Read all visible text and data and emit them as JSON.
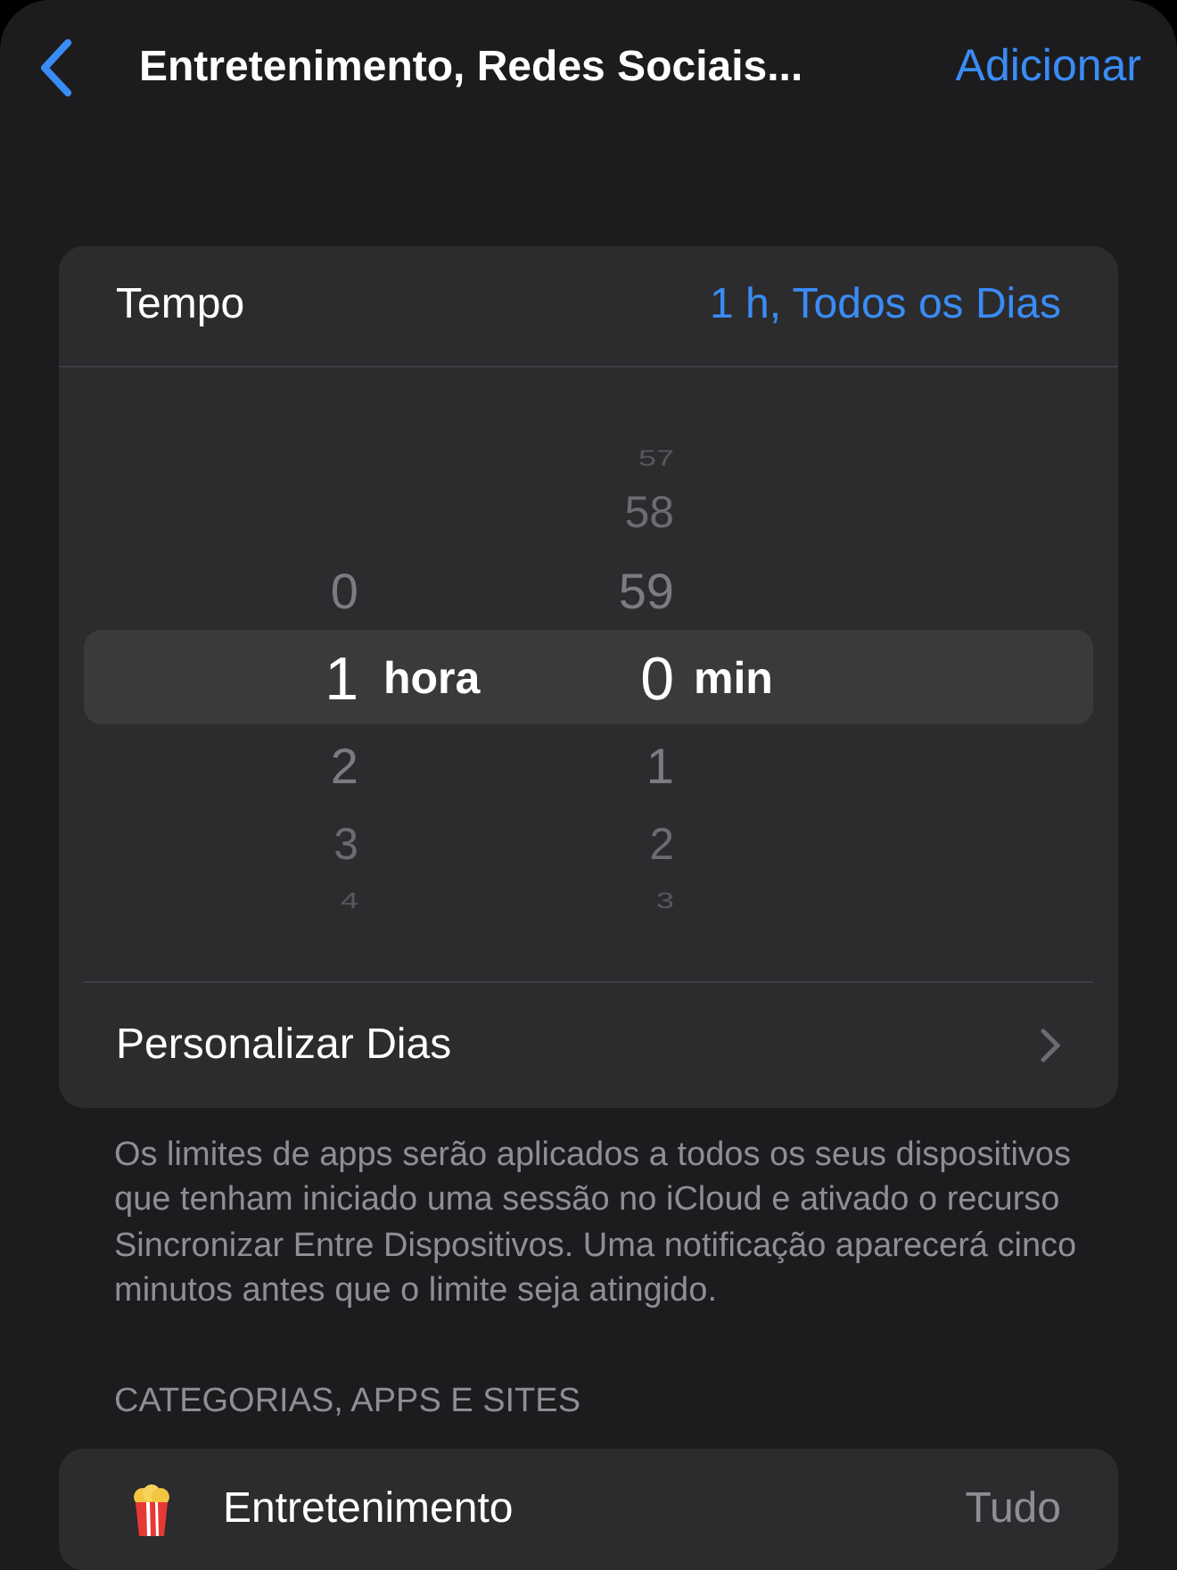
{
  "nav": {
    "title": "Entretenimento, Redes Sociais...",
    "action": "Adicionar"
  },
  "time_row": {
    "label": "Tempo",
    "value": "1 h, Todos os Dias"
  },
  "picker": {
    "columns": [
      {
        "unit": "hora",
        "items": [
          {
            "label": "0",
            "selected": false
          },
          {
            "label": "1",
            "selected": true
          },
          {
            "label": "2",
            "selected": false
          },
          {
            "label": "3",
            "selected": false
          },
          {
            "label": "4",
            "selected": false
          }
        ]
      },
      {
        "unit": "min",
        "items": [
          {
            "label": "57",
            "selected": false
          },
          {
            "label": "58",
            "selected": false
          },
          {
            "label": "59",
            "selected": false
          },
          {
            "label": "0",
            "selected": true
          },
          {
            "label": "1",
            "selected": false
          },
          {
            "label": "2",
            "selected": false
          },
          {
            "label": "3",
            "selected": false
          }
        ]
      }
    ]
  },
  "customize_row": {
    "label": "Personalizar Dias"
  },
  "footnote": "Os limites de apps serão aplicados a todos os seus dispositivos que tenham iniciado uma sessão no iCloud e ativado o recurso Sincronizar Entre Dispositivos. Uma notificação aparecerá cinco minutos antes que o limite seja atingido.",
  "section_header": "CATEGORIAS, APPS E SITES",
  "categories": [
    {
      "name": "Entretenimento",
      "value": "Tudo"
    }
  ]
}
